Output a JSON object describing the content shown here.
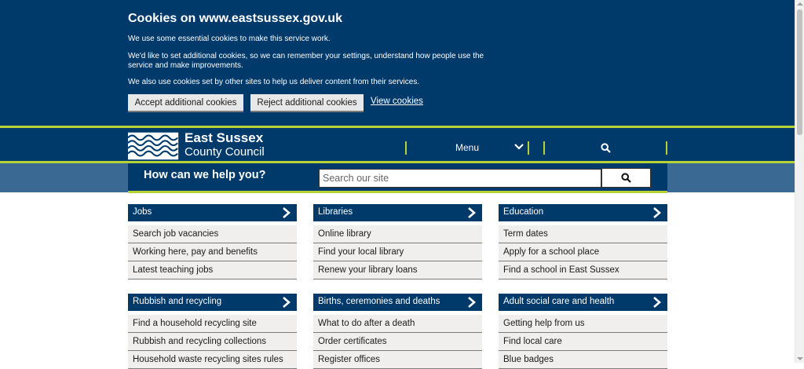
{
  "cookie": {
    "title": "Cookies on www.eastsussex.gov.uk",
    "p1": "We use some essential cookies to make this service work.",
    "p2": "We'd like to set additional cookies, so we can remember your settings, understand how people use the service and make improvements.",
    "p3": "We also use cookies set by other sites to help us deliver content from their services.",
    "accept_label": "Accept additional cookies",
    "reject_label": "Reject additional cookies",
    "view_label": "View cookies"
  },
  "header": {
    "logo_line1": "East Sussex",
    "logo_line2": "County Council",
    "menu_label": "Menu"
  },
  "help": {
    "title": "How can we help you?",
    "search_placeholder": "Search our site"
  },
  "cards": [
    {
      "title": "Jobs",
      "links": [
        "Search job vacancies",
        "Working here, pay and benefits",
        "Latest teaching jobs"
      ]
    },
    {
      "title": "Libraries",
      "links": [
        "Online library",
        "Find your local library",
        "Renew your library loans"
      ]
    },
    {
      "title": "Education",
      "links": [
        "Term dates",
        "Apply for a school place",
        "Find a school in East Sussex"
      ]
    },
    {
      "title": "Rubbish and recycling",
      "links": [
        "Find a household recycling site",
        "Rubbish and recycling collections",
        "Household waste recycling sites rules"
      ]
    },
    {
      "title": "Births, ceremonies and deaths",
      "links": [
        "What to do after a death",
        "Order certificates",
        "Register offices"
      ]
    },
    {
      "title": "Adult social care and health",
      "links": [
        "Getting help from us",
        "Find local care",
        "Blue badges"
      ]
    }
  ],
  "colors": {
    "navy": "#003a6b",
    "green": "#b5d334",
    "band": "#3a6a94",
    "link_bg": "#f0efed"
  }
}
